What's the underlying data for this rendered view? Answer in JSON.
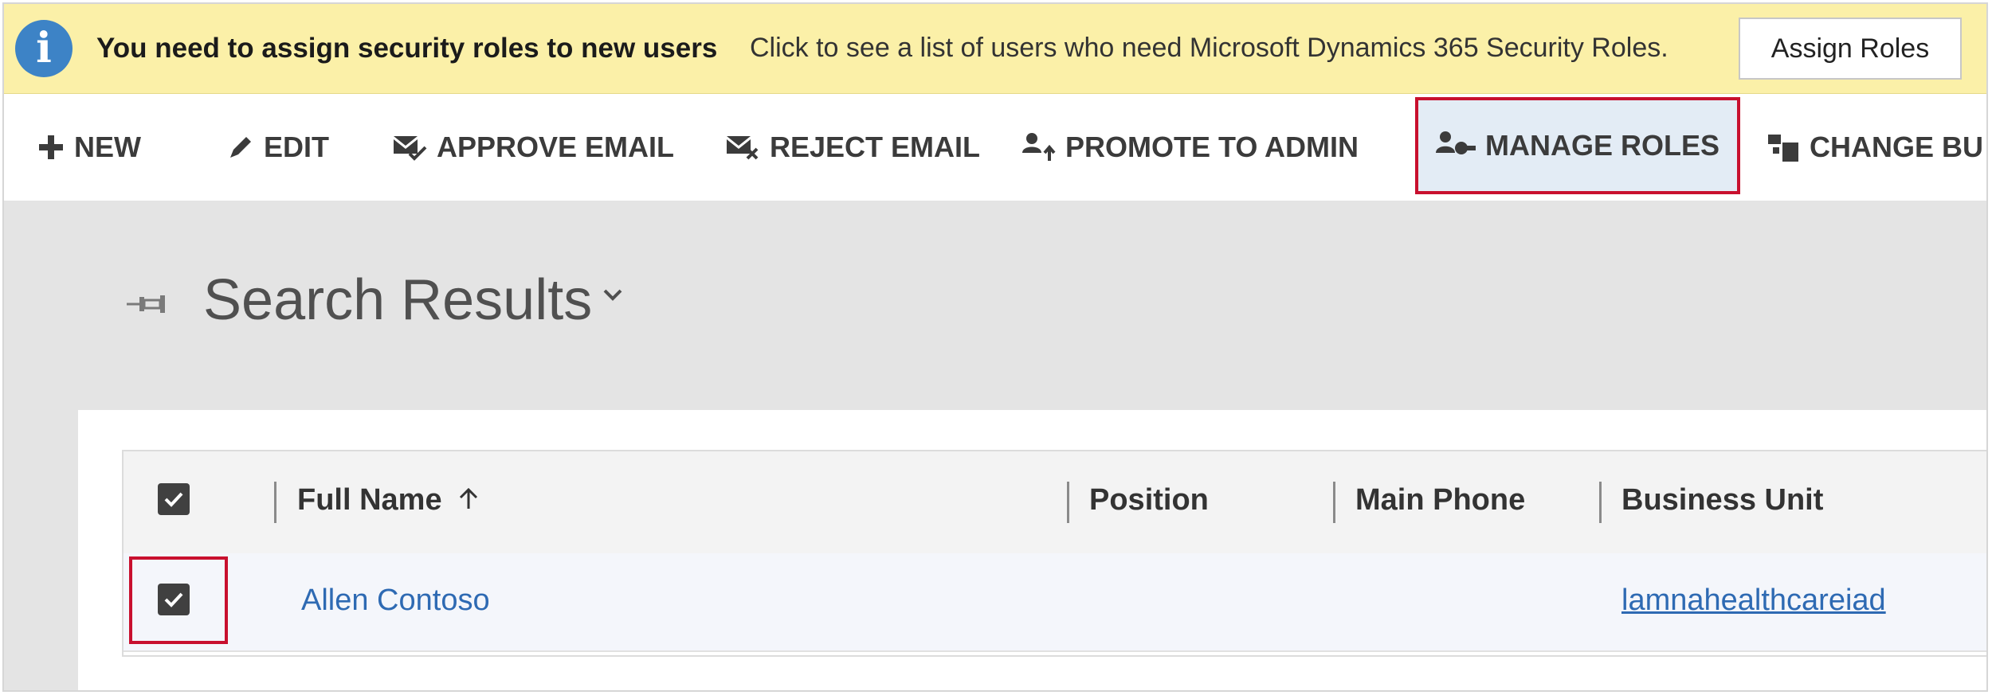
{
  "notification": {
    "title": "You need to assign security roles to new users",
    "message": "Click to see a list of users who need Microsoft Dynamics 365 Security Roles.",
    "button_label": "Assign Roles"
  },
  "commands": {
    "new": "NEW",
    "edit": "EDIT",
    "approve_email": "APPROVE EMAIL",
    "reject_email": "REJECT EMAIL",
    "promote_to_admin": "PROMOTE TO ADMIN",
    "manage_roles": "MANAGE ROLES",
    "change_business_unit": "CHANGE BU"
  },
  "view": {
    "title": "Search Results"
  },
  "grid": {
    "columns": {
      "full_name": "Full Name",
      "position": "Position",
      "main_phone": "Main Phone",
      "business_unit": "Business Unit"
    },
    "rows": [
      {
        "full_name": "Allen Contoso",
        "position": "",
        "main_phone": "",
        "business_unit": "lamnahealthcareiad",
        "selected": true
      }
    ]
  },
  "colors": {
    "notification_bg": "#fbf0a8",
    "info_icon": "#3d83c6",
    "highlight_border": "#c8102e",
    "link": "#2e6ab3"
  }
}
